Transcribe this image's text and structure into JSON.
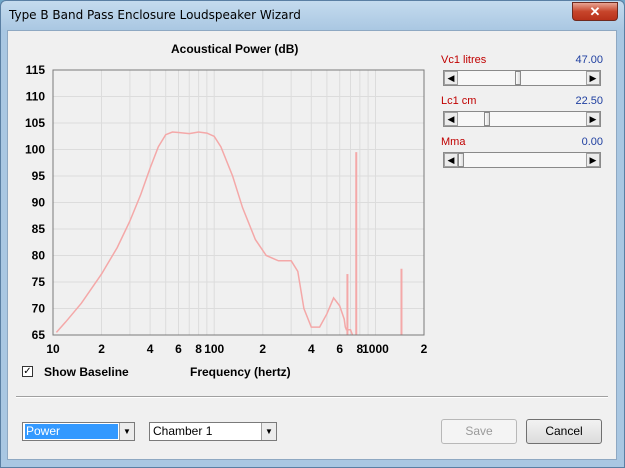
{
  "window": {
    "title": "Type B Band Pass Enclosure Loudspeaker Wizard",
    "close_glyph": "✕"
  },
  "chart_data": {
    "type": "line",
    "title": "Acoustical Power (dB)",
    "xlabel": "Frequency (hertz)",
    "ylabel": "",
    "x_scale": "log",
    "xlim": [
      10,
      2000
    ],
    "ylim": [
      65,
      115
    ],
    "grid": true,
    "y_ticks": [
      115,
      110,
      105,
      100,
      95,
      90,
      85,
      80,
      75,
      70,
      65
    ],
    "x_tick_labels": [
      {
        "x": 10,
        "label": "10"
      },
      {
        "x": 20,
        "label": "2"
      },
      {
        "x": 40,
        "label": "4"
      },
      {
        "x": 60,
        "label": "6"
      },
      {
        "x": 80,
        "label": "8"
      },
      {
        "x": 100,
        "label": "100"
      },
      {
        "x": 200,
        "label": "2"
      },
      {
        "x": 400,
        "label": "4"
      },
      {
        "x": 600,
        "label": "6"
      },
      {
        "x": 800,
        "label": "8"
      },
      {
        "x": 1000,
        "label": "1000"
      },
      {
        "x": 2000,
        "label": "2"
      }
    ],
    "series": [
      {
        "color": "#f4a8a8",
        "x": [
          10.5,
          12,
          15,
          20,
          25,
          30,
          35,
          40,
          45,
          50,
          55,
          60,
          70,
          80,
          90,
          100,
          110,
          130,
          150,
          180,
          210,
          250,
          300,
          330,
          360,
          400,
          450,
          500,
          550,
          600,
          640,
          650,
          660,
          700,
          720
        ],
        "y": [
          65.5,
          67.5,
          71,
          76.5,
          81.5,
          86.5,
          91.5,
          96.5,
          100.5,
          102.8,
          103.3,
          103.2,
          103.0,
          103.3,
          103.1,
          102.5,
          100.5,
          95,
          89,
          83,
          80,
          79,
          79,
          77,
          70,
          66.5,
          66.5,
          69,
          72,
          70.5,
          68,
          66.5,
          66,
          66,
          65
        ]
      }
    ],
    "spikes": [
      {
        "x": 670,
        "y": 76.5
      },
      {
        "x": 760,
        "y": 99.5
      },
      {
        "x": 1450,
        "y": 77.5
      }
    ]
  },
  "controls": [
    {
      "label": "Vc1  litres",
      "value": "47.00",
      "fraction": 0.46
    },
    {
      "label": "Lc1  cm",
      "value": "22.50",
      "fraction": 0.21
    },
    {
      "label": "Mma",
      "value": "0.00",
      "fraction": 0.0
    }
  ],
  "show_baseline": {
    "label": "Show Baseline",
    "checked": "✓"
  },
  "bottom": {
    "plot_select": "Power",
    "chamber_select": "Chamber 1",
    "save_label": "Save",
    "cancel_label": "Cancel",
    "dropdown_glyph": "▼"
  }
}
